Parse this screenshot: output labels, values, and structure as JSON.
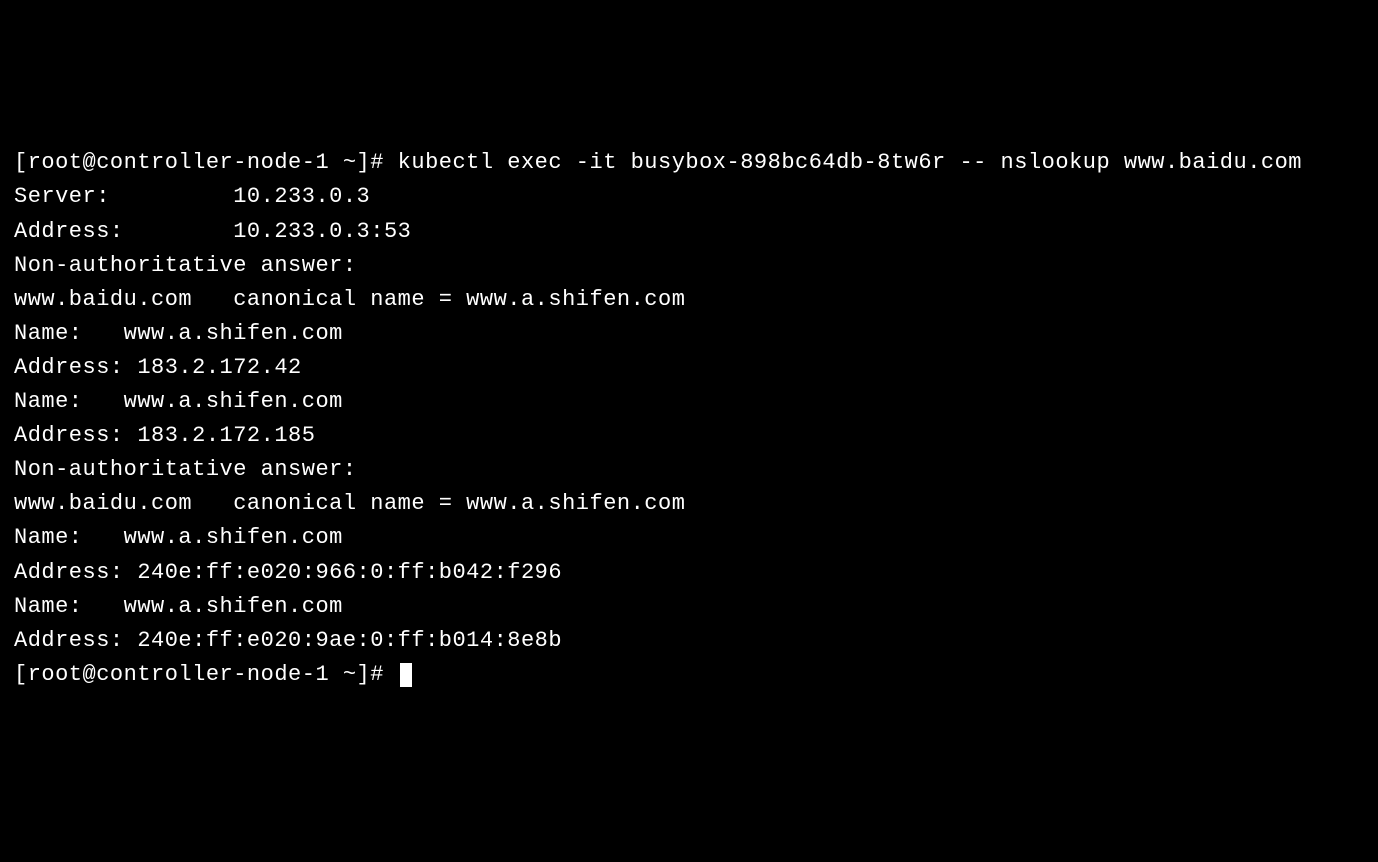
{
  "terminal": {
    "lines": [
      "[root@controller-node-1 ~]# kubectl exec -it busybox-898bc64db-8tw6r -- nslookup www.baidu.com",
      "Server:         10.233.0.3",
      "Address:        10.233.0.3:53",
      "",
      "Non-authoritative answer:",
      "www.baidu.com   canonical name = www.a.shifen.com",
      "Name:   www.a.shifen.com",
      "Address: 183.2.172.42",
      "Name:   www.a.shifen.com",
      "Address: 183.2.172.185",
      "",
      "Non-authoritative answer:",
      "www.baidu.com   canonical name = www.a.shifen.com",
      "Name:   www.a.shifen.com",
      "Address: 240e:ff:e020:966:0:ff:b042:f296",
      "Name:   www.a.shifen.com",
      "Address: 240e:ff:e020:9ae:0:ff:b014:8e8b",
      ""
    ],
    "prompt": "[root@controller-node-1 ~]# "
  }
}
